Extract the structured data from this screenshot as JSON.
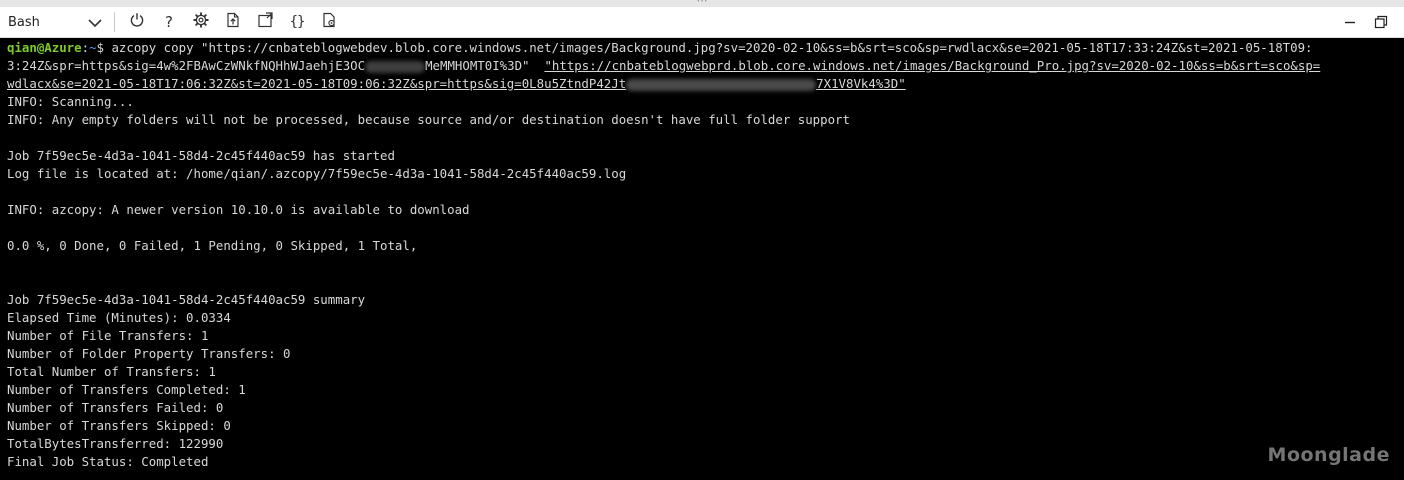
{
  "toolbar": {
    "shell_selector": {
      "label": "Bash"
    },
    "buttons": [
      {
        "name": "restart-icon"
      },
      {
        "name": "help-icon",
        "glyph": "?"
      },
      {
        "name": "settings-gear-icon"
      },
      {
        "name": "upload-download-files-icon"
      },
      {
        "name": "open-new-session-icon"
      },
      {
        "name": "editor-braces-icon",
        "glyph": "{}"
      },
      {
        "name": "web-preview-icon"
      }
    ],
    "window_buttons": [
      {
        "name": "minimize-icon"
      },
      {
        "name": "restore-icon"
      }
    ]
  },
  "terminal": {
    "prompt": {
      "user": "qian@Azure",
      "sep": ":",
      "path": "~",
      "symbol": "$ "
    },
    "command": {
      "part1": "azcopy copy \"https://cnbateblogwebdev.blob.core.windows.net/images/Background.jpg?sv=2020-02-10&ss=b&srt=sco&sp=rwdlacx&se=2021-05-18T17:33:24Z&st=2021-05-18T09:",
      "part2a": "3:24Z&spr=https&sig=4w%2FBAwCzWNkfNQHhWJaehjE3OC",
      "part2b": "MeMMHOMT0I%3D\"",
      "part2c": "  ",
      "part2d": "\"https://cnbateblogwebprd.blob.core.windows.net/images/Background_Pro.jpg?sv=2020-02-10&ss=b&srt=sco&sp=",
      "part3a": "wdlacx&se=2021-05-18T17:06:32Z&st=2021-05-18T09:06:32Z&spr=https&sig=0L8u5ZtndP42Jt",
      "part3b": "7X1V8Vk4%3D\""
    },
    "output": [
      "INFO: Scanning...",
      "INFO: Any empty folders will not be processed, because source and/or destination doesn't have full folder support",
      "",
      "Job 7f59ec5e-4d3a-1041-58d4-2c45f440ac59 has started",
      "Log file is located at: /home/qian/.azcopy/7f59ec5e-4d3a-1041-58d4-2c45f440ac59.log",
      "",
      "INFO: azcopy: A newer version 10.10.0 is available to download",
      "",
      "0.0 %, 0 Done, 0 Failed, 1 Pending, 0 Skipped, 1 Total,",
      "",
      "",
      "Job 7f59ec5e-4d3a-1041-58d4-2c45f440ac59 summary",
      "Elapsed Time (Minutes): 0.0334",
      "Number of File Transfers: 1",
      "Number of Folder Property Transfers: 0",
      "Total Number of Transfers: 1",
      "Number of Transfers Completed: 1",
      "Number of Transfers Failed: 0",
      "Number of Transfers Skipped: 0",
      "TotalBytesTransferred: 122990",
      "Final Job Status: Completed"
    ]
  },
  "watermark": "Moonglade",
  "colors": {
    "terminal_bg": "#000000",
    "terminal_text": "#d8d8d8",
    "prompt_user": "#7ccc2b",
    "prompt_path": "#5a9ef0",
    "toolbar_bg": "#ffffff"
  }
}
